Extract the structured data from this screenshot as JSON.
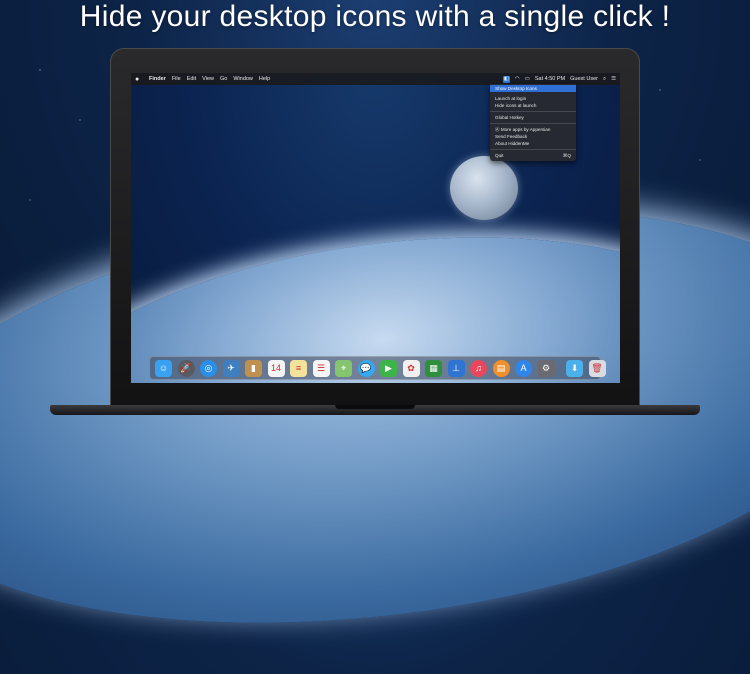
{
  "headline": "Hide your desktop icons with a single click !",
  "menubar": {
    "apple_icon": "apple-icon",
    "items": [
      "Finder",
      "File",
      "Edit",
      "View",
      "Go",
      "Window",
      "Help"
    ],
    "status": {
      "hider_icon": "hider-app-icon",
      "wifi_icon": "wifi-icon",
      "battery_icon": "battery-icon",
      "clock": "Sat 4:50 PM",
      "user": "Guest User",
      "search_icon": "spotlight-icon",
      "list_icon": "notification-center-icon"
    }
  },
  "dropdown": {
    "show_desktop_icons": "Show Desktop Icons",
    "launch_at_login": "Launch at login",
    "hide_icons_at_launch": "Hide icons at launch",
    "global_hotkey": "Global Hotkey",
    "more_apps": "More apps by Appersian",
    "send_feedback": "Send Feedback",
    "about": "About HiddenMe",
    "quit": "Quit",
    "quit_shortcut": "⌘Q"
  },
  "dock": {
    "apps": [
      {
        "name": "finder-icon",
        "color": "#3aa0f0",
        "glyph": "☺"
      },
      {
        "name": "launchpad-icon",
        "color": "#5a5a62",
        "glyph": "🚀"
      },
      {
        "name": "safari-icon",
        "color": "#2b8fe8",
        "glyph": "◎"
      },
      {
        "name": "photo-viewer-icon",
        "color": "#3f7fbf",
        "glyph": "✈"
      },
      {
        "name": "contacts-icon",
        "color": "#c09050",
        "glyph": "▮"
      },
      {
        "name": "calendar-icon",
        "color": "#f4f4f4",
        "glyph": "14"
      },
      {
        "name": "notes-icon",
        "color": "#f3e39a",
        "glyph": "≡"
      },
      {
        "name": "reminders-icon",
        "color": "#f5f5f5",
        "glyph": "☰"
      },
      {
        "name": "maps-icon",
        "color": "#86c56f",
        "glyph": "⌖"
      },
      {
        "name": "messages-icon",
        "color": "#35a8f0",
        "glyph": "💬"
      },
      {
        "name": "facetime-icon",
        "color": "#3cb44a",
        "glyph": "▶"
      },
      {
        "name": "photos-icon",
        "color": "#f0f0f0",
        "glyph": "✿"
      },
      {
        "name": "numbers-icon",
        "color": "#2e8f3d",
        "glyph": "▦"
      },
      {
        "name": "keynote-icon",
        "color": "#2f74d0",
        "glyph": "⊥"
      },
      {
        "name": "itunes-icon",
        "color": "#e8485d",
        "glyph": "♫"
      },
      {
        "name": "ibooks-icon",
        "color": "#f0902a",
        "glyph": "▤"
      },
      {
        "name": "app-store-icon",
        "color": "#2f86e8",
        "glyph": "A"
      },
      {
        "name": "system-preferences-icon",
        "color": "#6a6a70",
        "glyph": "⚙"
      }
    ],
    "right_apps": [
      {
        "name": "downloads-folder-icon",
        "color": "#4bb0ea",
        "glyph": "⬇"
      },
      {
        "name": "trash-icon",
        "color": "#d8dde4",
        "glyph": "🗑"
      }
    ]
  }
}
